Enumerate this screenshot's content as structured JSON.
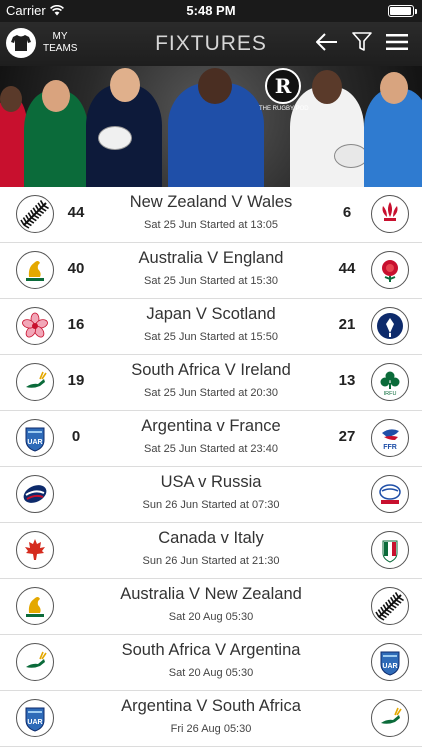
{
  "status_bar": {
    "carrier": "Carrier",
    "time": "5:48 PM",
    "battery_level": 0.95
  },
  "header": {
    "my_teams_label_line1": "MY",
    "my_teams_label_line2": "TEAMS",
    "title": "FIXTURES",
    "icons": [
      "back-arrow-icon",
      "filter-icon",
      "menu-icon"
    ]
  },
  "banner": {
    "logo_letter": "R",
    "logo_text": "THE RUGBY POD"
  },
  "fixtures": [
    {
      "match": "New Zealand V Wales",
      "info": "Sat 25 Jun Started at 13:05",
      "home_score": "44",
      "away_score": "6",
      "home_logo": "new-zealand-fern-icon",
      "away_logo": "wales-feathers-icon"
    },
    {
      "match": "Australia V England",
      "info": "Sat 25 Jun Started at 15:30",
      "home_score": "40",
      "away_score": "44",
      "home_logo": "australia-wallabies-icon",
      "away_logo": "england-rose-icon"
    },
    {
      "match": "Japan V Scotland",
      "info": "Sat 25 Jun Started at 15:50",
      "home_score": "16",
      "away_score": "21",
      "home_logo": "japan-blossom-icon",
      "away_logo": "scotland-thistle-icon"
    },
    {
      "match": "South Africa V Ireland",
      "info": "Sat 25 Jun Started at 20:30",
      "home_score": "19",
      "away_score": "13",
      "home_logo": "south-africa-springbok-icon",
      "away_logo": "ireland-shamrock-icon"
    },
    {
      "match": "Argentina v France",
      "info": "Sat 25 Jun Started at 23:40",
      "home_score": "0",
      "away_score": "27",
      "home_logo": "argentina-uar-icon",
      "away_logo": "france-ffr-icon"
    },
    {
      "match": "USA v Russia",
      "info": "Sun 26 Jun Started at 07:30",
      "home_score": "",
      "away_score": "",
      "home_logo": "usa-rugby-icon",
      "away_logo": "russia-rugby-icon"
    },
    {
      "match": "Canada v Italy",
      "info": "Sun 26 Jun Started at 21:30",
      "home_score": "",
      "away_score": "",
      "home_logo": "canada-maple-icon",
      "away_logo": "italy-fir-icon"
    },
    {
      "match": "Australia V New Zealand",
      "info": "Sat 20 Aug 05:30",
      "home_score": "",
      "away_score": "",
      "home_logo": "australia-wallabies-icon",
      "away_logo": "new-zealand-fern-icon"
    },
    {
      "match": "South Africa V Argentina",
      "info": "Sat 20 Aug 05:30",
      "home_score": "",
      "away_score": "",
      "home_logo": "south-africa-springbok-icon",
      "away_logo": "argentina-uar-icon"
    },
    {
      "match": "Argentina V South Africa",
      "info": "Fri 26 Aug 05:30",
      "home_score": "",
      "away_score": "",
      "home_logo": "argentina-uar-icon",
      "away_logo": "south-africa-springbok-icon"
    }
  ],
  "logo_text": {
    "uar": "UAR",
    "ffr": "FFR",
    "irfu": "IRFU",
    "wru": "W.R.U."
  }
}
